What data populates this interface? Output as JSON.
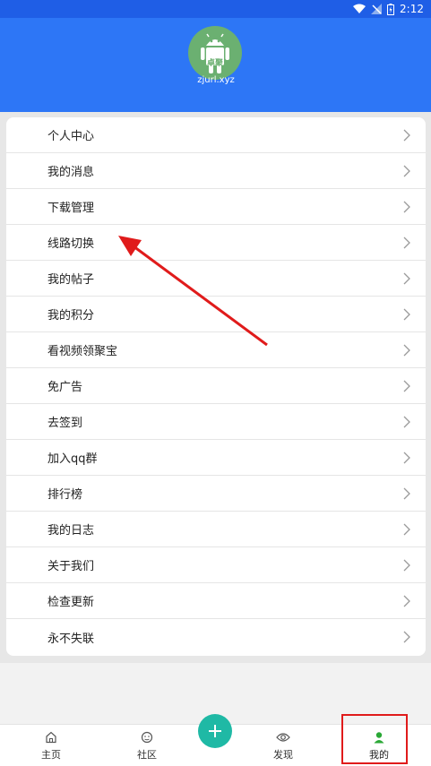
{
  "status_bar": {
    "time": "2:12"
  },
  "header": {
    "avatar_text": "卓聚",
    "avatar_url_text": "zjurl.xyz"
  },
  "menu": {
    "items": [
      {
        "label": "个人中心"
      },
      {
        "label": "我的消息"
      },
      {
        "label": "下载管理"
      },
      {
        "label": "线路切换"
      },
      {
        "label": "我的帖子"
      },
      {
        "label": "我的积分"
      },
      {
        "label": "看视频领聚宝"
      },
      {
        "label": "免广告"
      },
      {
        "label": "去签到"
      },
      {
        "label": "加入qq群"
      },
      {
        "label": "排行榜"
      },
      {
        "label": "我的日志"
      },
      {
        "label": "关于我们"
      },
      {
        "label": "检查更新"
      },
      {
        "label": "永不失联"
      }
    ]
  },
  "tabbar": {
    "tabs": [
      {
        "label": "主页",
        "icon": "home-icon"
      },
      {
        "label": "社区",
        "icon": "smile-icon"
      },
      {
        "label": "发现",
        "icon": "eye-icon"
      },
      {
        "label": "我的",
        "icon": "person-icon"
      }
    ],
    "active_color": "#2aa836",
    "fab_color": "#1fb9a5"
  },
  "annotations": {
    "arrow_color": "#e01b1b"
  }
}
